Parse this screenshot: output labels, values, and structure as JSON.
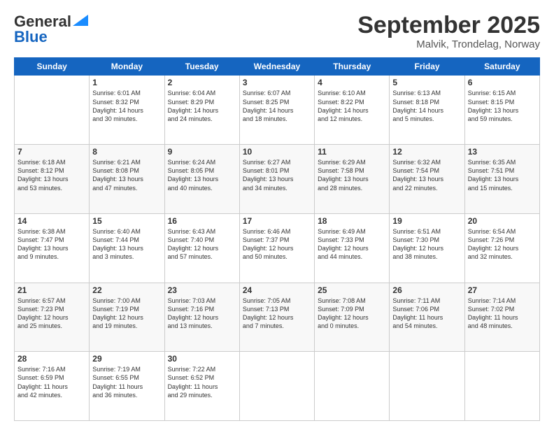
{
  "header": {
    "logo_line1": "General",
    "logo_line2": "Blue",
    "month": "September 2025",
    "location": "Malvik, Trondelag, Norway"
  },
  "days_of_week": [
    "Sunday",
    "Monday",
    "Tuesday",
    "Wednesday",
    "Thursday",
    "Friday",
    "Saturday"
  ],
  "weeks": [
    [
      {
        "day": "",
        "info": ""
      },
      {
        "day": "1",
        "info": "Sunrise: 6:01 AM\nSunset: 8:32 PM\nDaylight: 14 hours\nand 30 minutes."
      },
      {
        "day": "2",
        "info": "Sunrise: 6:04 AM\nSunset: 8:29 PM\nDaylight: 14 hours\nand 24 minutes."
      },
      {
        "day": "3",
        "info": "Sunrise: 6:07 AM\nSunset: 8:25 PM\nDaylight: 14 hours\nand 18 minutes."
      },
      {
        "day": "4",
        "info": "Sunrise: 6:10 AM\nSunset: 8:22 PM\nDaylight: 14 hours\nand 12 minutes."
      },
      {
        "day": "5",
        "info": "Sunrise: 6:13 AM\nSunset: 8:18 PM\nDaylight: 14 hours\nand 5 minutes."
      },
      {
        "day": "6",
        "info": "Sunrise: 6:15 AM\nSunset: 8:15 PM\nDaylight: 13 hours\nand 59 minutes."
      }
    ],
    [
      {
        "day": "7",
        "info": "Sunrise: 6:18 AM\nSunset: 8:12 PM\nDaylight: 13 hours\nand 53 minutes."
      },
      {
        "day": "8",
        "info": "Sunrise: 6:21 AM\nSunset: 8:08 PM\nDaylight: 13 hours\nand 47 minutes."
      },
      {
        "day": "9",
        "info": "Sunrise: 6:24 AM\nSunset: 8:05 PM\nDaylight: 13 hours\nand 40 minutes."
      },
      {
        "day": "10",
        "info": "Sunrise: 6:27 AM\nSunset: 8:01 PM\nDaylight: 13 hours\nand 34 minutes."
      },
      {
        "day": "11",
        "info": "Sunrise: 6:29 AM\nSunset: 7:58 PM\nDaylight: 13 hours\nand 28 minutes."
      },
      {
        "day": "12",
        "info": "Sunrise: 6:32 AM\nSunset: 7:54 PM\nDaylight: 13 hours\nand 22 minutes."
      },
      {
        "day": "13",
        "info": "Sunrise: 6:35 AM\nSunset: 7:51 PM\nDaylight: 13 hours\nand 15 minutes."
      }
    ],
    [
      {
        "day": "14",
        "info": "Sunrise: 6:38 AM\nSunset: 7:47 PM\nDaylight: 13 hours\nand 9 minutes."
      },
      {
        "day": "15",
        "info": "Sunrise: 6:40 AM\nSunset: 7:44 PM\nDaylight: 13 hours\nand 3 minutes."
      },
      {
        "day": "16",
        "info": "Sunrise: 6:43 AM\nSunset: 7:40 PM\nDaylight: 12 hours\nand 57 minutes."
      },
      {
        "day": "17",
        "info": "Sunrise: 6:46 AM\nSunset: 7:37 PM\nDaylight: 12 hours\nand 50 minutes."
      },
      {
        "day": "18",
        "info": "Sunrise: 6:49 AM\nSunset: 7:33 PM\nDaylight: 12 hours\nand 44 minutes."
      },
      {
        "day": "19",
        "info": "Sunrise: 6:51 AM\nSunset: 7:30 PM\nDaylight: 12 hours\nand 38 minutes."
      },
      {
        "day": "20",
        "info": "Sunrise: 6:54 AM\nSunset: 7:26 PM\nDaylight: 12 hours\nand 32 minutes."
      }
    ],
    [
      {
        "day": "21",
        "info": "Sunrise: 6:57 AM\nSunset: 7:23 PM\nDaylight: 12 hours\nand 25 minutes."
      },
      {
        "day": "22",
        "info": "Sunrise: 7:00 AM\nSunset: 7:19 PM\nDaylight: 12 hours\nand 19 minutes."
      },
      {
        "day": "23",
        "info": "Sunrise: 7:03 AM\nSunset: 7:16 PM\nDaylight: 12 hours\nand 13 minutes."
      },
      {
        "day": "24",
        "info": "Sunrise: 7:05 AM\nSunset: 7:13 PM\nDaylight: 12 hours\nand 7 minutes."
      },
      {
        "day": "25",
        "info": "Sunrise: 7:08 AM\nSunset: 7:09 PM\nDaylight: 12 hours\nand 0 minutes."
      },
      {
        "day": "26",
        "info": "Sunrise: 7:11 AM\nSunset: 7:06 PM\nDaylight: 11 hours\nand 54 minutes."
      },
      {
        "day": "27",
        "info": "Sunrise: 7:14 AM\nSunset: 7:02 PM\nDaylight: 11 hours\nand 48 minutes."
      }
    ],
    [
      {
        "day": "28",
        "info": "Sunrise: 7:16 AM\nSunset: 6:59 PM\nDaylight: 11 hours\nand 42 minutes."
      },
      {
        "day": "29",
        "info": "Sunrise: 7:19 AM\nSunset: 6:55 PM\nDaylight: 11 hours\nand 36 minutes."
      },
      {
        "day": "30",
        "info": "Sunrise: 7:22 AM\nSunset: 6:52 PM\nDaylight: 11 hours\nand 29 minutes."
      },
      {
        "day": "",
        "info": ""
      },
      {
        "day": "",
        "info": ""
      },
      {
        "day": "",
        "info": ""
      },
      {
        "day": "",
        "info": ""
      }
    ]
  ]
}
